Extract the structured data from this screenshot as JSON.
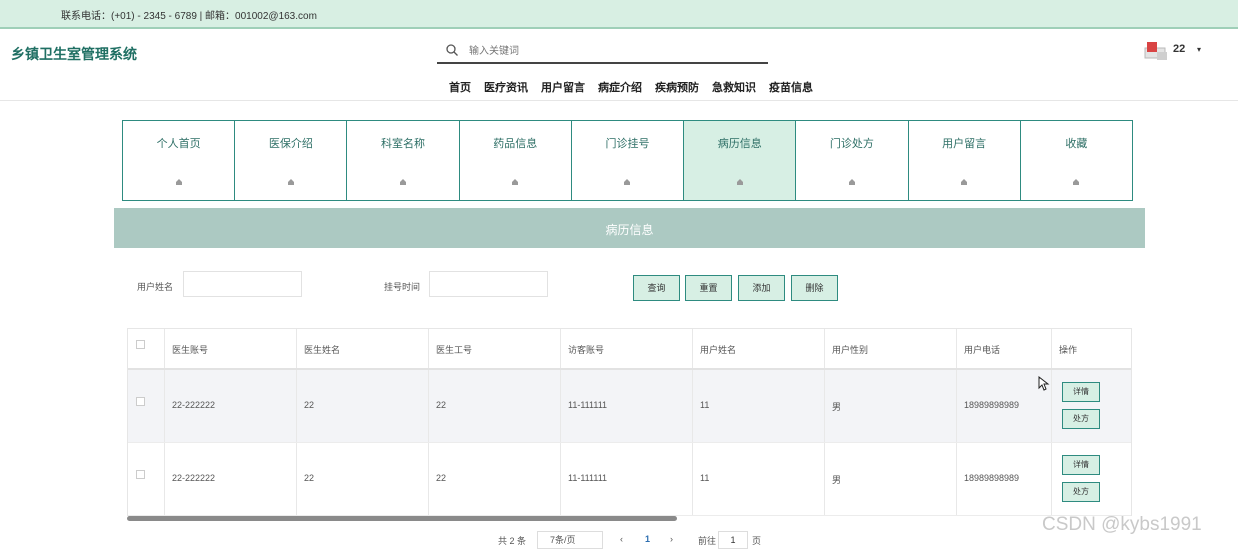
{
  "topbar": {
    "contact": "联系电话：(+01) - 2345 - 6789 | 邮箱：001002@163.com"
  },
  "header": {
    "logo": "乡镇卫生室管理系统",
    "search_placeholder": "输入关键词",
    "username": "22",
    "caret": "▾"
  },
  "nav": [
    "首页",
    "医疗资讯",
    "用户留言",
    "病症介绍",
    "疾病预防",
    "急救知识",
    "疫苗信息"
  ],
  "cards": [
    {
      "label": "个人首页",
      "active": false
    },
    {
      "label": "医保介绍",
      "active": false
    },
    {
      "label": "科室名称",
      "active": false
    },
    {
      "label": "药品信息",
      "active": false
    },
    {
      "label": "门诊挂号",
      "active": false
    },
    {
      "label": "病历信息",
      "active": true
    },
    {
      "label": "门诊处方",
      "active": false
    },
    {
      "label": "用户留言",
      "active": false
    },
    {
      "label": "收藏",
      "active": false
    }
  ],
  "banner": {
    "title": "病历信息"
  },
  "filters": {
    "user_name_label": "用户姓名",
    "reg_time_label": "挂号时间",
    "query": "查询",
    "reset": "重置",
    "add": "添加",
    "delete": "删除"
  },
  "table": {
    "headers": [
      "医生账号",
      "医生姓名",
      "医生工号",
      "访客账号",
      "用户姓名",
      "用户性别",
      "用户电话",
      "操作"
    ],
    "rows": [
      [
        "22-222222",
        "22",
        "22",
        "11-111111",
        "11",
        "男",
        "18989898989"
      ],
      [
        "22-222222",
        "22",
        "22",
        "11-111111",
        "11",
        "男",
        "18989898989"
      ]
    ],
    "detail_btn": "详情",
    "prescription_btn": "处方"
  },
  "pager": {
    "total": "共 2 条",
    "page_size": "7条/页",
    "prev": "‹",
    "current": "1",
    "next": "›",
    "goto": "前往",
    "goto_value": "1",
    "page_unit": "页"
  },
  "watermark": "CSDN @kybs1991",
  "colors": {
    "accent": "#2e8b80",
    "banner": "#acc9c2",
    "topbar": "#d8efe3"
  }
}
